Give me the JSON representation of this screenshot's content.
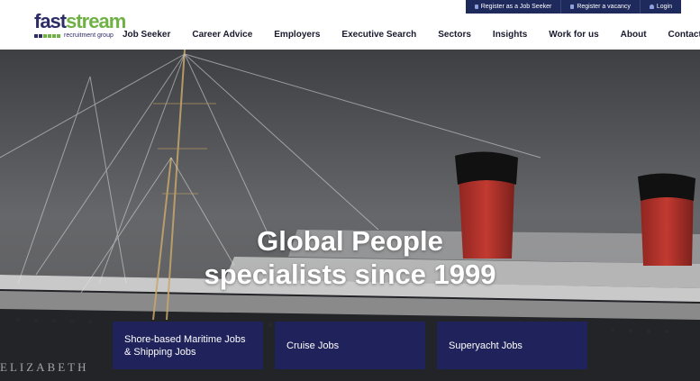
{
  "utility_bar": {
    "register_job_seeker": "Register as a Job Seeker",
    "register_vacancy": "Register a vacancy",
    "login": "Login"
  },
  "logo": {
    "wordmark_fast": "fast",
    "wordmark_stream": "stream",
    "tagline": "recruitment group"
  },
  "nav": {
    "items": [
      "Job Seeker",
      "Career Advice",
      "Employers",
      "Executive Search",
      "Sectors",
      "Insights",
      "Work for us",
      "About",
      "Contact Us"
    ]
  },
  "hero": {
    "title_line1": "Global People",
    "title_line2": "specialists since 1999",
    "ship_name": "ELIZABETH",
    "cards": [
      {
        "label": "Shore-based Maritime Jobs & Shipping Jobs"
      },
      {
        "label": "Cruise Jobs"
      },
      {
        "label": "Superyacht Jobs"
      }
    ]
  },
  "colors": {
    "brand_navy": "#2c2d66",
    "brand_green": "#6fb144",
    "util_bar": "#1f2a5c",
    "card_bg": "#21235f",
    "funnel_red": "#b2302a"
  }
}
